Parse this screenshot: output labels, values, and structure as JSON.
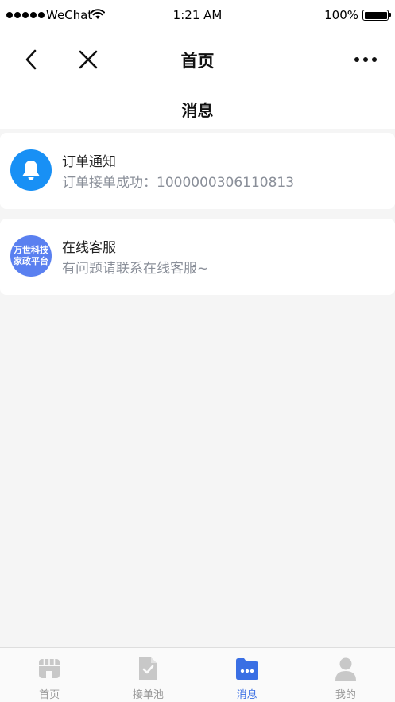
{
  "status_bar": {
    "carrier": "WeChat",
    "time": "1:21 AM",
    "battery": "100%"
  },
  "navbar": {
    "title": "首页"
  },
  "page_subtitle": "消息",
  "messages": [
    {
      "title": "订单通知",
      "preview": "订单接单成功：1000000306110813",
      "icon": "bell-icon",
      "avatar_color": "#1890f5"
    },
    {
      "title": "在线客服",
      "preview": "有问题请联系在线客服~",
      "avatar_line1": "万世科技",
      "avatar_line2": "家政平台",
      "avatar_color": "#5a80f0"
    }
  ],
  "tabbar": {
    "items": [
      {
        "label": "首页",
        "icon": "store-icon",
        "active": false
      },
      {
        "label": "接单池",
        "icon": "document-check-icon",
        "active": false
      },
      {
        "label": "消息",
        "icon": "message-folder-icon",
        "active": true
      },
      {
        "label": "我的",
        "icon": "user-icon",
        "active": false
      }
    ]
  },
  "colors": {
    "accent": "#3a6fe4",
    "inactive": "#c8c8c8",
    "background": "#f5f5f5"
  }
}
